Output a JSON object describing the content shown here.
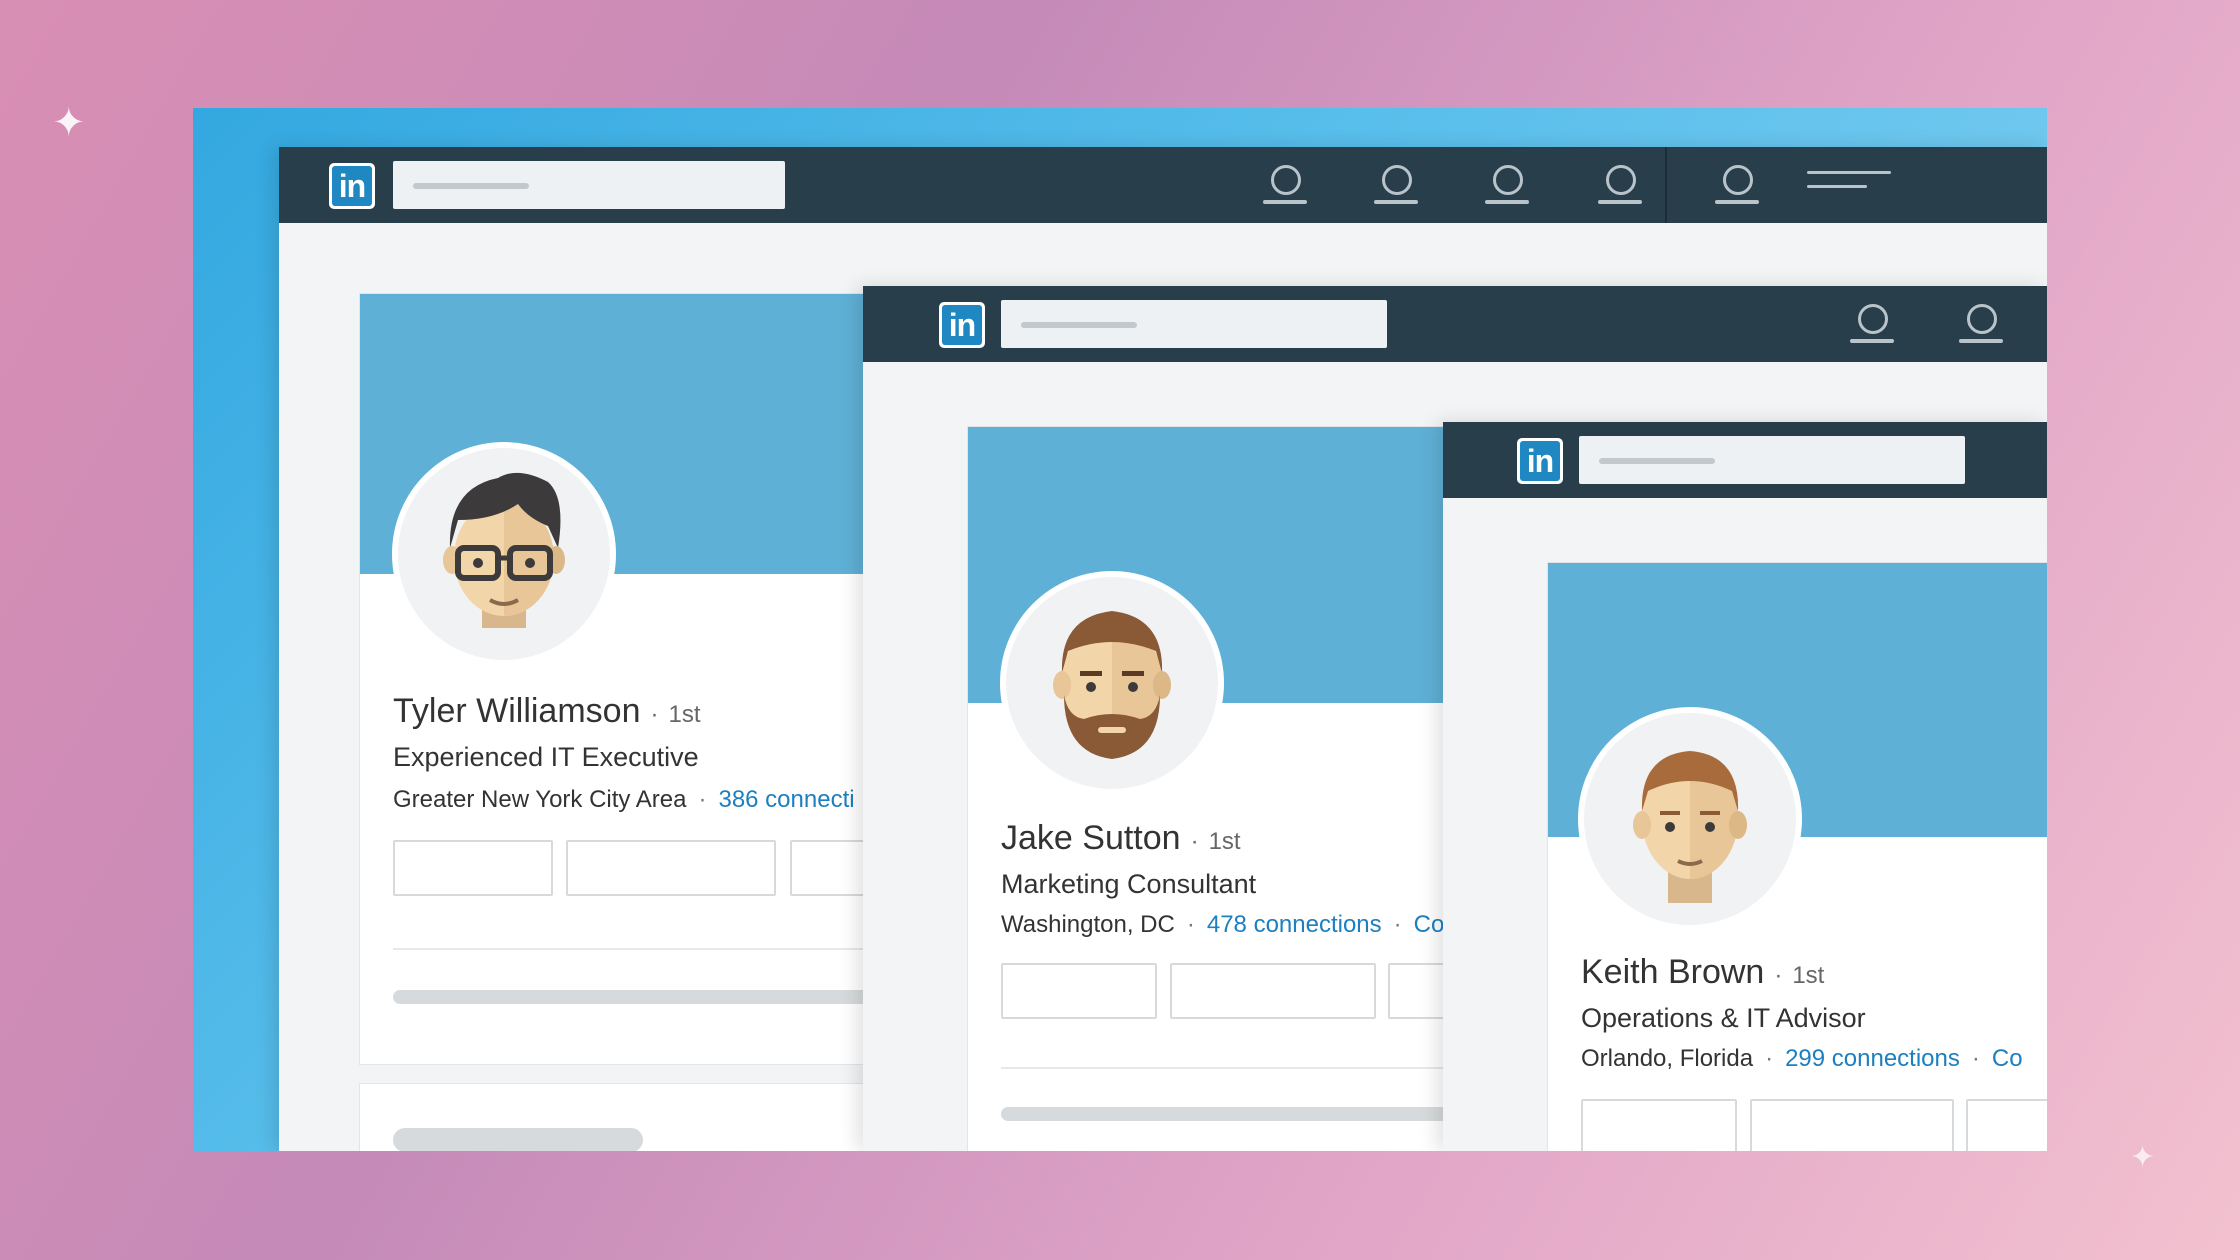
{
  "windows": [
    {
      "profile": {
        "name": "Tyler Williamson",
        "degree": "1st",
        "headline": "Experienced IT Executive",
        "location": "Greater New York City Area",
        "connections": "386 connecti"
      }
    },
    {
      "profile": {
        "name": "Jake Sutton",
        "degree": "1st",
        "headline": "Marketing Consultant",
        "location": "Washington, DC",
        "connections": "478 connections",
        "contact": "Co"
      }
    },
    {
      "profile": {
        "name": "Keith Brown",
        "degree": "1st",
        "headline": "Operations & IT Advisor",
        "location": "Orlando, Florida",
        "connections": "299 connections",
        "contact": "Co"
      }
    }
  ],
  "brand": {
    "logo_text": "in",
    "separator": "·"
  },
  "colors": {
    "navbar": "#283e4a",
    "logo_blue": "#1f87c2",
    "banner": "#5fb0d6",
    "link": "#1c7fc0"
  }
}
